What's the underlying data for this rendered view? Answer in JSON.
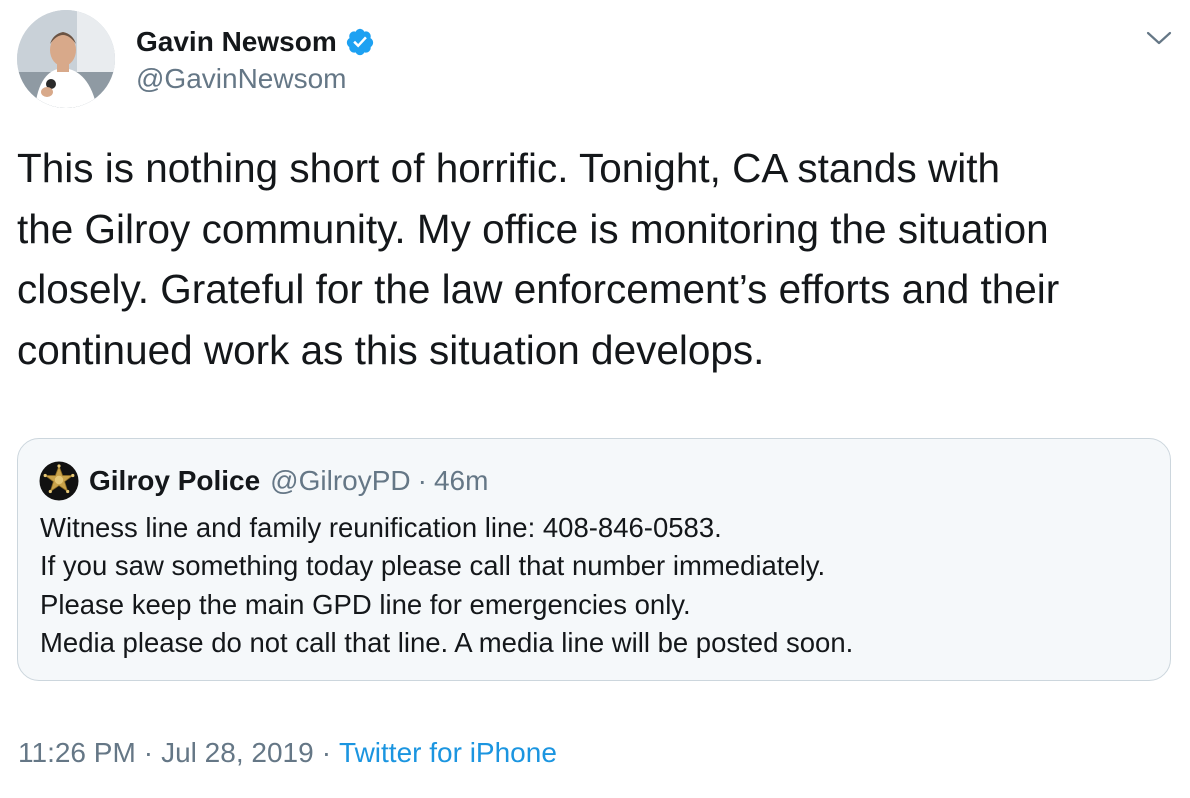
{
  "author": {
    "name": "Gavin Newsom",
    "handle": "@GavinNewsom",
    "verified": true
  },
  "tweet_lines": [
    "This is nothing short of horrific.  Tonight, CA stands with",
    "the Gilroy community. My office is monitoring the situation",
    "closely. Grateful for the law enforcement’s efforts and their",
    "continued work as this situation develops."
  ],
  "quoted_tweet": {
    "name": "Gilroy Police",
    "handle": "@GilroyPD",
    "separator": "·",
    "time": "46m",
    "lines": [
      "Witness line and family reunification line: 408-846-0583.",
      "If you saw something today please call that number immediately.",
      "Please keep the main GPD line for emergencies only.",
      "Media please do not call that line. A media line will be posted soon."
    ]
  },
  "meta": {
    "time": "11:26 PM",
    "separator": "·",
    "date": "Jul 28, 2019",
    "source": "Twitter for iPhone"
  },
  "icons": {
    "verified_badge": "verified-check-icon",
    "more_menu": "chevron-down-icon",
    "police_badge": "police-star-badge-icon"
  },
  "colors": {
    "text": "#14171a",
    "secondary": "#657786",
    "link": "#1b95e0",
    "verified": "#1da1f2",
    "quote_border": "#ccd6dd",
    "quote_bg": "#f5f8fa"
  }
}
